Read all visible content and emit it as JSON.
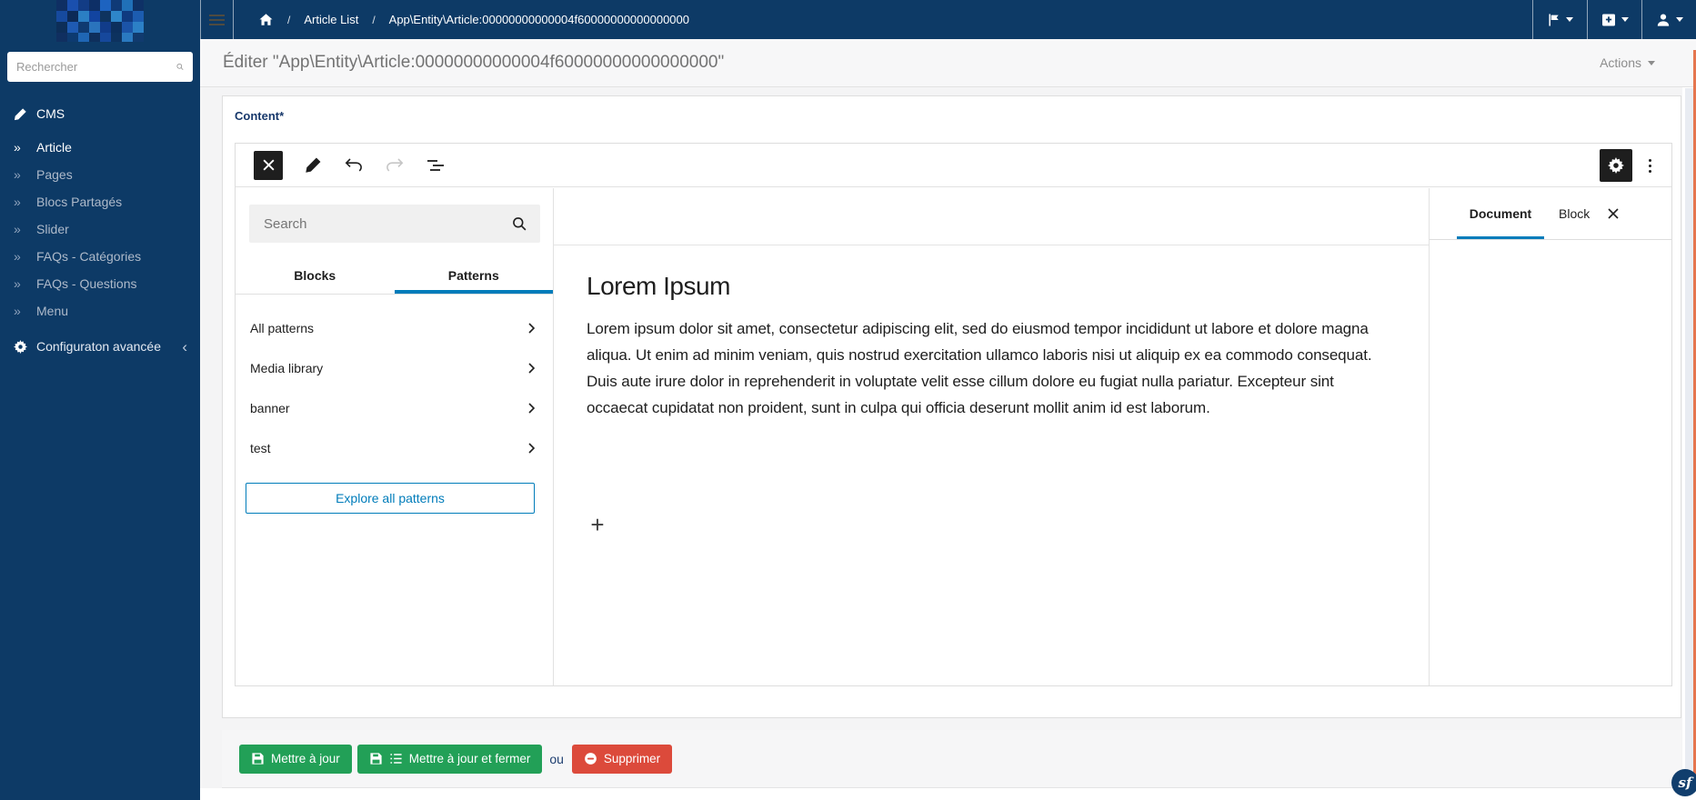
{
  "colors": {
    "navy": "#0d3a66",
    "wp_blue": "#007cba",
    "editor_dark": "#1e1e1e",
    "green": "#22a057",
    "red": "#dc4a3b",
    "orange_scroll": "#e5764f"
  },
  "sidebar": {
    "search_placeholder": "Rechercher",
    "section_label": "CMS",
    "items": [
      {
        "label": "Article",
        "active": true
      },
      {
        "label": "Pages",
        "active": false
      },
      {
        "label": "Blocs Partagés",
        "active": false
      },
      {
        "label": "Slider",
        "active": false
      },
      {
        "label": "FAQs - Catégories",
        "active": false
      },
      {
        "label": "FAQs - Questions",
        "active": false
      },
      {
        "label": "Menu",
        "active": false
      }
    ],
    "advanced_label": "Configuraton avancée"
  },
  "navbar": {
    "breadcrumb": [
      "Article List",
      "App\\Entity\\Article:00000000000004f60000000000000000"
    ]
  },
  "page_header": {
    "title": "Éditer \"App\\Entity\\Article:00000000000004f60000000000000000\"",
    "actions_label": "Actions"
  },
  "form": {
    "content_label": "Content*"
  },
  "editor": {
    "inserter": {
      "search_placeholder": "Search",
      "tabs": [
        {
          "label": "Blocks",
          "active": false
        },
        {
          "label": "Patterns",
          "active": true
        }
      ],
      "categories": [
        "All patterns",
        "Media library",
        "banner",
        "test"
      ],
      "explore_label": "Explore all patterns"
    },
    "canvas": {
      "heading": "Lorem Ipsum",
      "paragraph": "Lorem ipsum dolor sit amet, consectetur adipiscing elit, sed do eiusmod tempor incididunt ut labore et dolore magna aliqua. Ut enim ad minim veniam, quis nostrud exercitation ullamco laboris nisi ut aliquip ex ea commodo consequat. Duis aute irure dolor in reprehenderit in voluptate velit esse cillum dolore eu fugiat nulla pariatur. Excepteur sint occaecat cupidatat non proident, sunt in culpa qui officia deserunt mollit anim id est laborum.",
      "appender_label": "+"
    },
    "inspector": {
      "tabs": [
        {
          "label": "Document",
          "active": true
        },
        {
          "label": "Block",
          "active": false
        }
      ]
    }
  },
  "footer": {
    "update_label": "Mettre à jour",
    "update_close_label": "Mettre à jour et fermer",
    "or_label": "ou",
    "delete_label": "Supprimer"
  },
  "debug_badge": "sf"
}
